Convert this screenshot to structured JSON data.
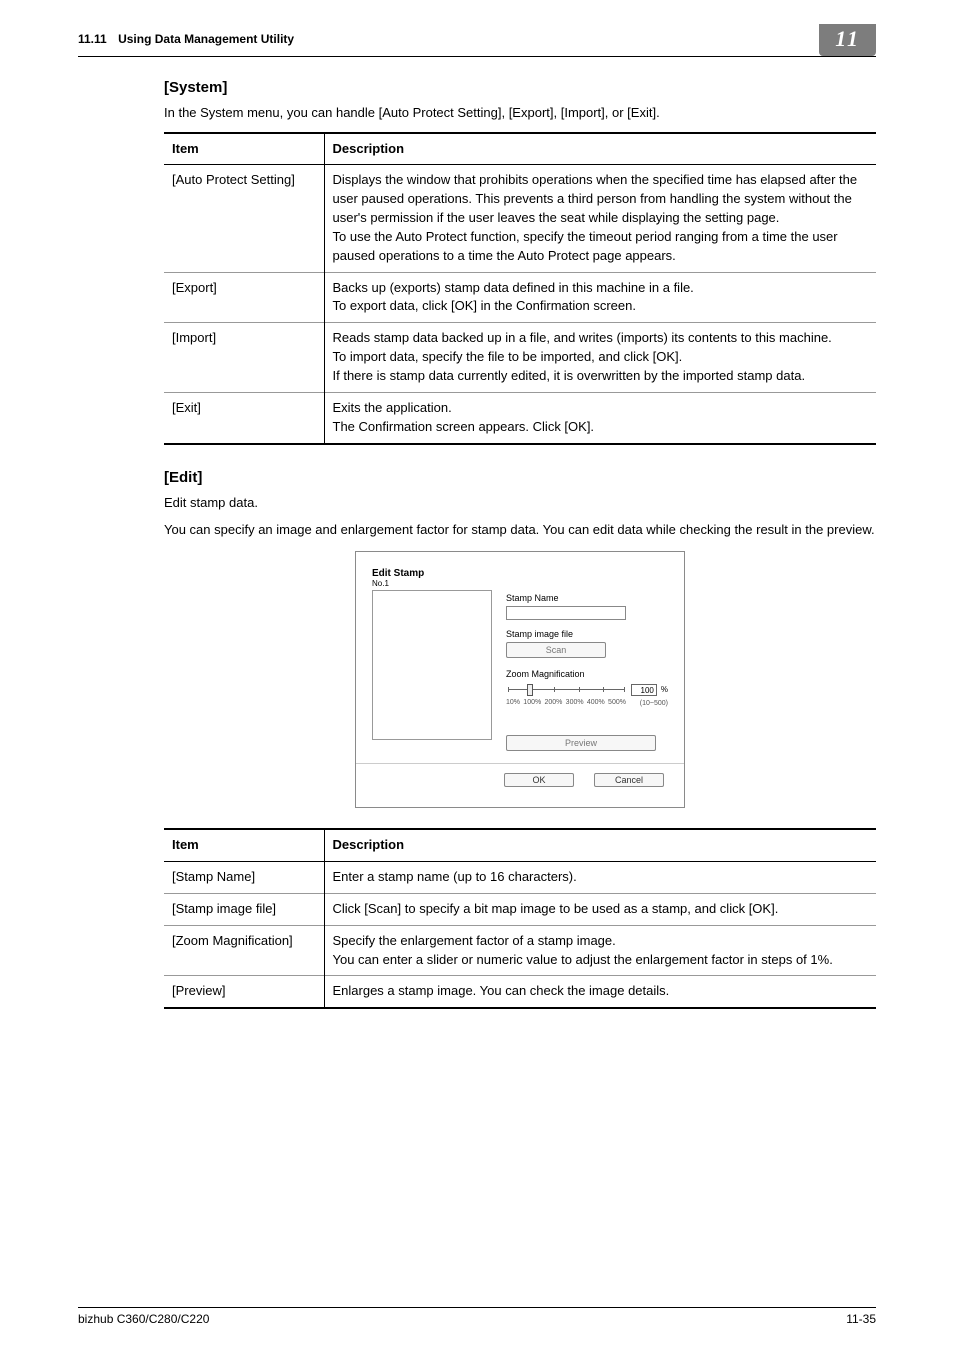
{
  "running_header": {
    "section_number": "11.11",
    "section_title": "Using Data Management Utility",
    "chapter_badge": "11"
  },
  "sections": {
    "system": {
      "heading": "[System]",
      "intro": "In the System menu, you can handle [Auto Protect Setting], [Export], [Import], or [Exit].",
      "table": {
        "head_item": "Item",
        "head_desc": "Description",
        "rows": [
          {
            "item": "[Auto Protect Setting]",
            "desc": "Displays the window that prohibits operations when the specified time has elapsed after the user paused operations. This prevents a third person from handling the system without the user's permission if the user leaves the seat while displaying the setting page.\nTo use the Auto Protect function, specify the timeout period ranging from a time the user paused operations to a time the Auto Protect page appears."
          },
          {
            "item": "[Export]",
            "desc": "Backs up (exports) stamp data defined in this machine in a file.\nTo export data, click [OK] in the Confirmation screen."
          },
          {
            "item": "[Import]",
            "desc": "Reads stamp data backed up in a file, and writes (imports) its contents to this machine.\nTo import data, specify the file to be imported, and click [OK].\nIf there is stamp data currently edited, it is overwritten by the imported stamp data."
          },
          {
            "item": "[Exit]",
            "desc": "Exits the application.\nThe Confirmation screen appears. Click [OK]."
          }
        ]
      }
    },
    "edit": {
      "heading": "[Edit]",
      "intro1": "Edit stamp data.",
      "intro2": "You can specify an image and enlargement factor for stamp data. You can edit data while checking the result in the preview.",
      "table": {
        "head_item": "Item",
        "head_desc": "Description",
        "rows": [
          {
            "item": "[Stamp Name]",
            "desc": "Enter a stamp name (up to 16 characters)."
          },
          {
            "item": "[Stamp image file]",
            "desc": "Click [Scan] to specify a bit map image to be used as a stamp, and click [OK]."
          },
          {
            "item": "[Zoom Magnification]",
            "desc": "Specify the enlargement factor of a stamp image.\nYou can enter a slider or numeric value to adjust the enlargement factor in steps of 1%."
          },
          {
            "item": "[Preview]",
            "desc": "Enlarges a stamp image. You can check the image details."
          }
        ]
      }
    }
  },
  "dialog": {
    "title": "Edit Stamp",
    "subtitle": "No.1",
    "labels": {
      "stamp_name": "Stamp Name",
      "stamp_image_file": "Stamp image file",
      "scan_btn": "Scan",
      "zoom_magnification": "Zoom Magnification",
      "preview_btn": "Preview",
      "ok": "OK",
      "cancel": "Cancel"
    },
    "zoom": {
      "value": "100",
      "unit": "%",
      "range_hint": "(10~500)",
      "ticks": [
        "10%",
        "100%",
        "200%",
        "300%",
        "400%",
        "500%"
      ]
    },
    "stamp_name_value": ""
  },
  "footer": {
    "model": "bizhub C360/C280/C220",
    "page": "11-35"
  }
}
